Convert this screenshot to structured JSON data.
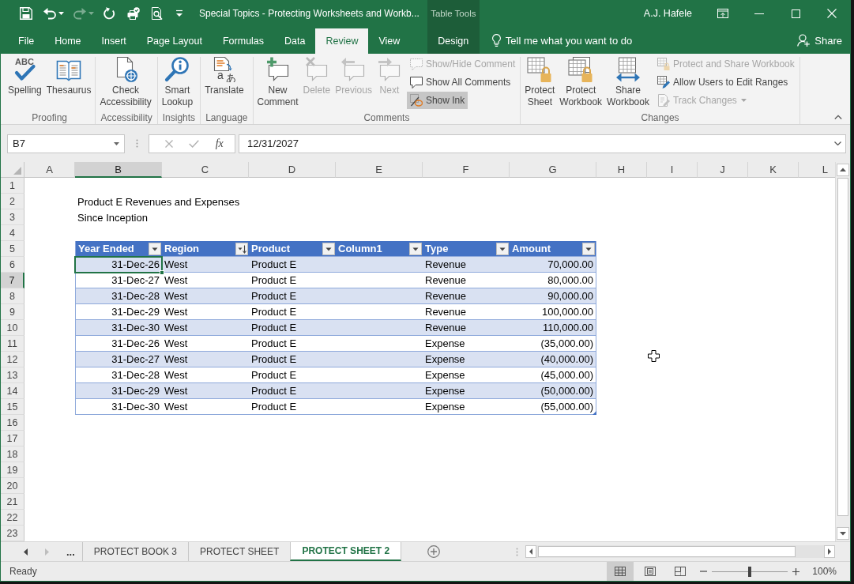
{
  "title_bar": {
    "quick_access": [
      {
        "disabled": false
      },
      {
        "disabled": false
      },
      {
        "disabled": true
      },
      {
        "disabled": false
      },
      {
        "disabled": false
      },
      {
        "disabled": false
      },
      {
        "disabled": false
      }
    ],
    "title": "Special Topics - Protecting Worksheets and Workb...",
    "contextual_group": "Table Tools",
    "user": "A.J. Hafele"
  },
  "ribbon_tabs": [
    {
      "label": "File",
      "selected": false,
      "kind": "standard"
    },
    {
      "label": "Home",
      "selected": false,
      "kind": "standard"
    },
    {
      "label": "Insert",
      "selected": false,
      "kind": "standard"
    },
    {
      "label": "Page Layout",
      "selected": false,
      "kind": "standard"
    },
    {
      "label": "Formulas",
      "selected": false,
      "kind": "standard"
    },
    {
      "label": "Data",
      "selected": false,
      "kind": "standard"
    },
    {
      "label": "Review",
      "selected": true,
      "kind": "standard"
    },
    {
      "label": "View",
      "selected": false,
      "kind": "standard"
    },
    {
      "label": "Design",
      "selected": false,
      "kind": "contextual"
    }
  ],
  "tell_me": "Tell me what you want to do",
  "share": "Share",
  "ribbon_groups": [
    {
      "label": "Proofing",
      "commands": [
        {
          "label": "Spelling",
          "kind": "large",
          "disabled": false,
          "on": false,
          "icon_text": [
            "ABC"
          ]
        },
        {
          "label": "Thesaurus",
          "kind": "large",
          "disabled": false,
          "on": false
        }
      ]
    },
    {
      "label": "Accessibility",
      "commands": [
        {
          "label": "Check Accessibility",
          "kind": "large",
          "disabled": false,
          "on": false
        }
      ]
    },
    {
      "label": "Insights",
      "commands": [
        {
          "label": "Smart Lookup",
          "kind": "large",
          "disabled": false,
          "on": false
        }
      ]
    },
    {
      "label": "Language",
      "commands": [
        {
          "label": "Translate",
          "kind": "large",
          "disabled": false,
          "on": false,
          "icon_text": [
            "a",
            "あ"
          ]
        }
      ]
    },
    {
      "label": "Comments",
      "commands": [
        {
          "label": "New Comment",
          "kind": "large",
          "disabled": false,
          "on": false
        },
        {
          "label": "Delete",
          "kind": "large",
          "disabled": true,
          "on": false
        },
        {
          "label": "Previous",
          "kind": "large",
          "disabled": true,
          "on": false
        },
        {
          "label": "Next",
          "kind": "large",
          "disabled": true,
          "on": false
        },
        {
          "label": "Show/Hide Comment",
          "kind": "small",
          "disabled": true,
          "on": false
        },
        {
          "label": "Show All Comments",
          "kind": "small",
          "disabled": false,
          "on": false
        },
        {
          "label": "Show Ink",
          "kind": "small",
          "disabled": false,
          "on": true
        }
      ]
    },
    {
      "label": "Changes",
      "commands": [
        {
          "label": "Protect Sheet",
          "kind": "large",
          "disabled": false,
          "on": false
        },
        {
          "label": "Protect Workbook",
          "kind": "large",
          "disabled": false,
          "on": false
        },
        {
          "label": "Share Workbook",
          "kind": "large",
          "disabled": false,
          "on": false
        },
        {
          "label": "Protect and Share Workbook",
          "kind": "small",
          "disabled": true,
          "on": false
        },
        {
          "label": "Allow Users to Edit Ranges",
          "kind": "small",
          "disabled": false,
          "on": false
        },
        {
          "label": "Track Changes",
          "kind": "small-menu",
          "disabled": true,
          "on": false
        }
      ]
    }
  ],
  "formula_bar": {
    "name_box": "B7",
    "function_label": "fx",
    "formula": "12/31/2027"
  },
  "sheet": {
    "columns": [
      {
        "label": "A",
        "selected": false
      },
      {
        "label": "B",
        "selected": true
      },
      {
        "label": "C",
        "selected": false
      },
      {
        "label": "D",
        "selected": false
      },
      {
        "label": "E",
        "selected": false
      },
      {
        "label": "F",
        "selected": false
      },
      {
        "label": "G",
        "selected": false
      },
      {
        "label": "H",
        "selected": false
      },
      {
        "label": "I",
        "selected": false
      },
      {
        "label": "J",
        "selected": false
      },
      {
        "label": "K",
        "selected": false
      },
      {
        "label": "L",
        "selected": false
      }
    ],
    "rows": [
      {
        "label": "1",
        "selected": false
      },
      {
        "label": "2",
        "selected": false
      },
      {
        "label": "3",
        "selected": false
      },
      {
        "label": "4",
        "selected": false
      },
      {
        "label": "5",
        "selected": false
      },
      {
        "label": "6",
        "selected": false
      },
      {
        "label": "7",
        "selected": true
      },
      {
        "label": "8",
        "selected": false
      },
      {
        "label": "9",
        "selected": false
      },
      {
        "label": "10",
        "selected": false
      },
      {
        "label": "11",
        "selected": false
      },
      {
        "label": "12",
        "selected": false
      },
      {
        "label": "13",
        "selected": false
      },
      {
        "label": "14",
        "selected": false
      },
      {
        "label": "15",
        "selected": false
      },
      {
        "label": "16",
        "selected": false
      },
      {
        "label": "17",
        "selected": false
      },
      {
        "label": "18",
        "selected": false
      },
      {
        "label": "19",
        "selected": false
      },
      {
        "label": "20",
        "selected": false
      },
      {
        "label": "21",
        "selected": false
      },
      {
        "label": "22",
        "selected": false
      },
      {
        "label": "23",
        "selected": false
      }
    ],
    "notes": [
      "Product E Revenues and Expenses",
      "Since Inception"
    ],
    "table": {
      "columns": [
        {
          "label": "Year Ended",
          "sorted": false
        },
        {
          "label": "Region",
          "sorted": true
        },
        {
          "label": "Product",
          "sorted": false
        },
        {
          "label": "Column1",
          "sorted": false
        },
        {
          "label": "Type",
          "sorted": false
        },
        {
          "label": "Amount",
          "sorted": false
        }
      ],
      "rows": [
        {
          "year_ended": "31-Dec-26",
          "region": "West",
          "product": "Product E",
          "type": "Revenue",
          "amount": "70,000.00"
        },
        {
          "year_ended": "31-Dec-27",
          "region": "West",
          "product": "Product E",
          "type": "Revenue",
          "amount": "80,000.00"
        },
        {
          "year_ended": "31-Dec-28",
          "region": "West",
          "product": "Product E",
          "type": "Revenue",
          "amount": "90,000.00"
        },
        {
          "year_ended": "31-Dec-29",
          "region": "West",
          "product": "Product E",
          "type": "Revenue",
          "amount": "100,000.00"
        },
        {
          "year_ended": "31-Dec-30",
          "region": "West",
          "product": "Product E",
          "type": "Revenue",
          "amount": "110,000.00"
        },
        {
          "year_ended": "31-Dec-26",
          "region": "West",
          "product": "Product E",
          "type": "Expense",
          "amount": "(35,000.00)"
        },
        {
          "year_ended": "31-Dec-27",
          "region": "West",
          "product": "Product E",
          "type": "Expense",
          "amount": "(40,000.00)"
        },
        {
          "year_ended": "31-Dec-28",
          "region": "West",
          "product": "Product E",
          "type": "Expense",
          "amount": "(45,000.00)"
        },
        {
          "year_ended": "31-Dec-29",
          "region": "West",
          "product": "Product E",
          "type": "Expense",
          "amount": "(50,000.00)"
        },
        {
          "year_ended": "31-Dec-30",
          "region": "West",
          "product": "Product E",
          "type": "Expense",
          "amount": "(55,000.00)"
        }
      ]
    }
  },
  "sheet_tabs": {
    "scroll_buttons": [
      {
        "disabled": false
      },
      {
        "disabled": true
      }
    ],
    "overflow": "...",
    "tabs": [
      {
        "label": "PROTECT BOOK 3",
        "selected": false
      },
      {
        "label": "PROTECT SHEET",
        "selected": false
      },
      {
        "label": "PROTECT SHEET 2",
        "selected": true
      }
    ]
  },
  "status_bar": {
    "status": "Ready",
    "views": [
      {
        "selected": true
      },
      {
        "selected": false
      },
      {
        "selected": false
      }
    ],
    "zoom": {
      "level": 0.5,
      "reading": "100%"
    }
  }
}
